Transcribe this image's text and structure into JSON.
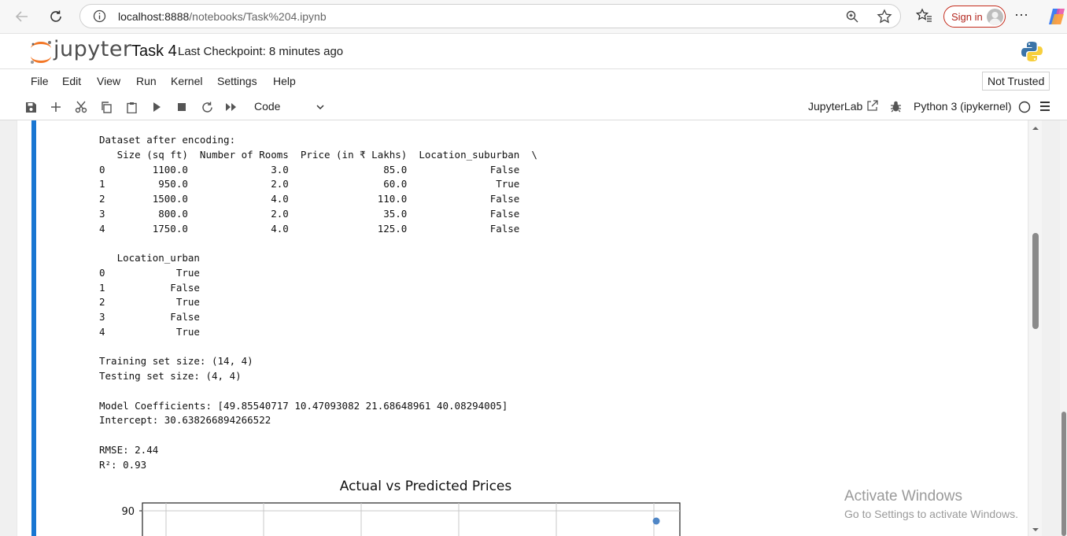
{
  "browser": {
    "url_host": "localhost:8888",
    "url_path": "/notebooks/Task%204.ipynb",
    "signin_label": "Sign in",
    "more_label": "⋯"
  },
  "jupyter": {
    "logo_text": "jupyter",
    "notebook_title": "Task 4",
    "checkpoint": "Last Checkpoint: 8 minutes ago"
  },
  "menu": {
    "items": [
      "File",
      "Edit",
      "View",
      "Run",
      "Kernel",
      "Settings",
      "Help"
    ],
    "trust_status": "Not Trusted"
  },
  "toolbar": {
    "cell_type": "Code",
    "jupyterlab_label": "JupyterLab",
    "kernel_name": "Python 3 (ipykernel)"
  },
  "output": {
    "text": "Dataset after encoding:\n   Size (sq ft)  Number of Rooms  Price (in ₹ Lakhs)  Location_suburban  \\\n0        1100.0              3.0                85.0              False   \n1         950.0              2.0                60.0               True   \n2        1500.0              4.0               110.0              False   \n3         800.0              2.0                35.0              False   \n4        1750.0              4.0               125.0              False   \n\n   Location_urban  \n0            True  \n1           False  \n2            True  \n3           False  \n4            True  \n\nTraining set size: (14, 4)\nTesting set size: (4, 4)\n\nModel Coefficients: [49.85540717 10.47093082 21.68648961 40.08294005]\nIntercept: 30.638266894266522\n\nRMSE: 2.44\nR²: 0.93"
  },
  "chart_data": {
    "type": "scatter",
    "title": "Actual vs Predicted Prices",
    "y_tick_labels": [
      "90"
    ],
    "points": [
      {
        "x": null,
        "y": 88
      }
    ],
    "grid": true,
    "point_color": "#4f86c6"
  },
  "watermark": {
    "title": "Activate Windows",
    "subtitle": "Go to Settings to activate Windows."
  }
}
